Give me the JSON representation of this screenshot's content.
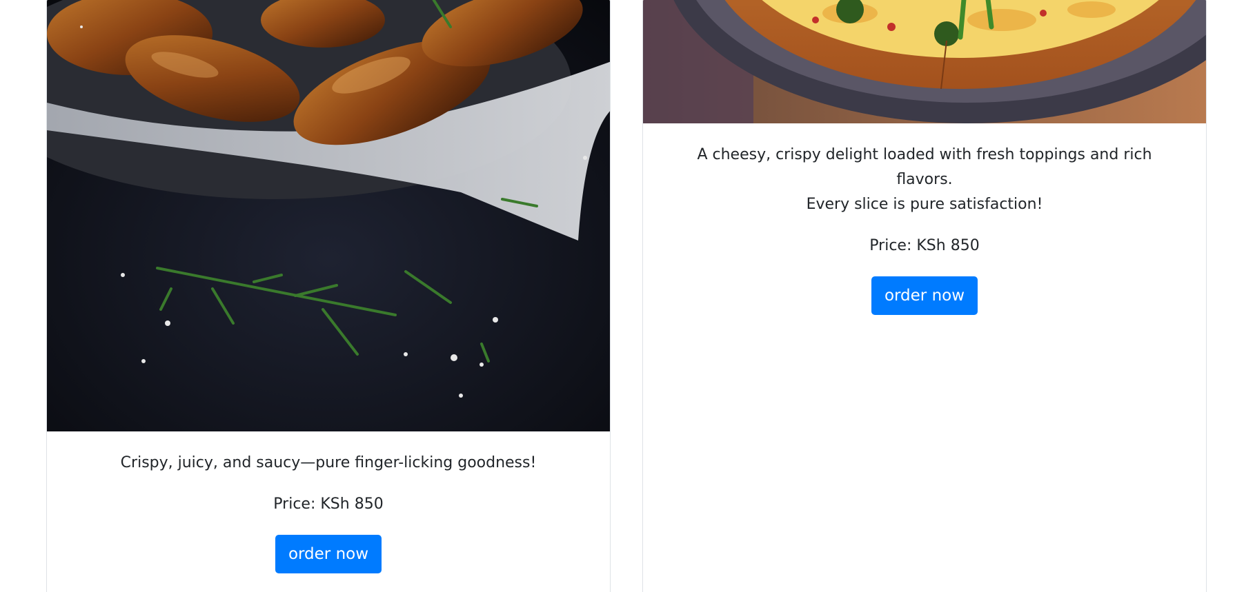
{
  "cards": [
    {
      "image": "chicken-wings-photo",
      "description": "Crispy, juicy, and saucy—pure finger-licking goodness!",
      "price": "Price: KSh 850",
      "button": "order now"
    },
    {
      "image": "pizza-photo",
      "description_line1": "A cheesy, crispy delight loaded with fresh toppings and rich flavors.",
      "description_line2": "Every slice is pure satisfaction!",
      "price": "Price: KSh 850",
      "button": "order now"
    }
  ],
  "colors": {
    "button": "#007bff",
    "text": "#212529",
    "border": "#dee2e6"
  }
}
